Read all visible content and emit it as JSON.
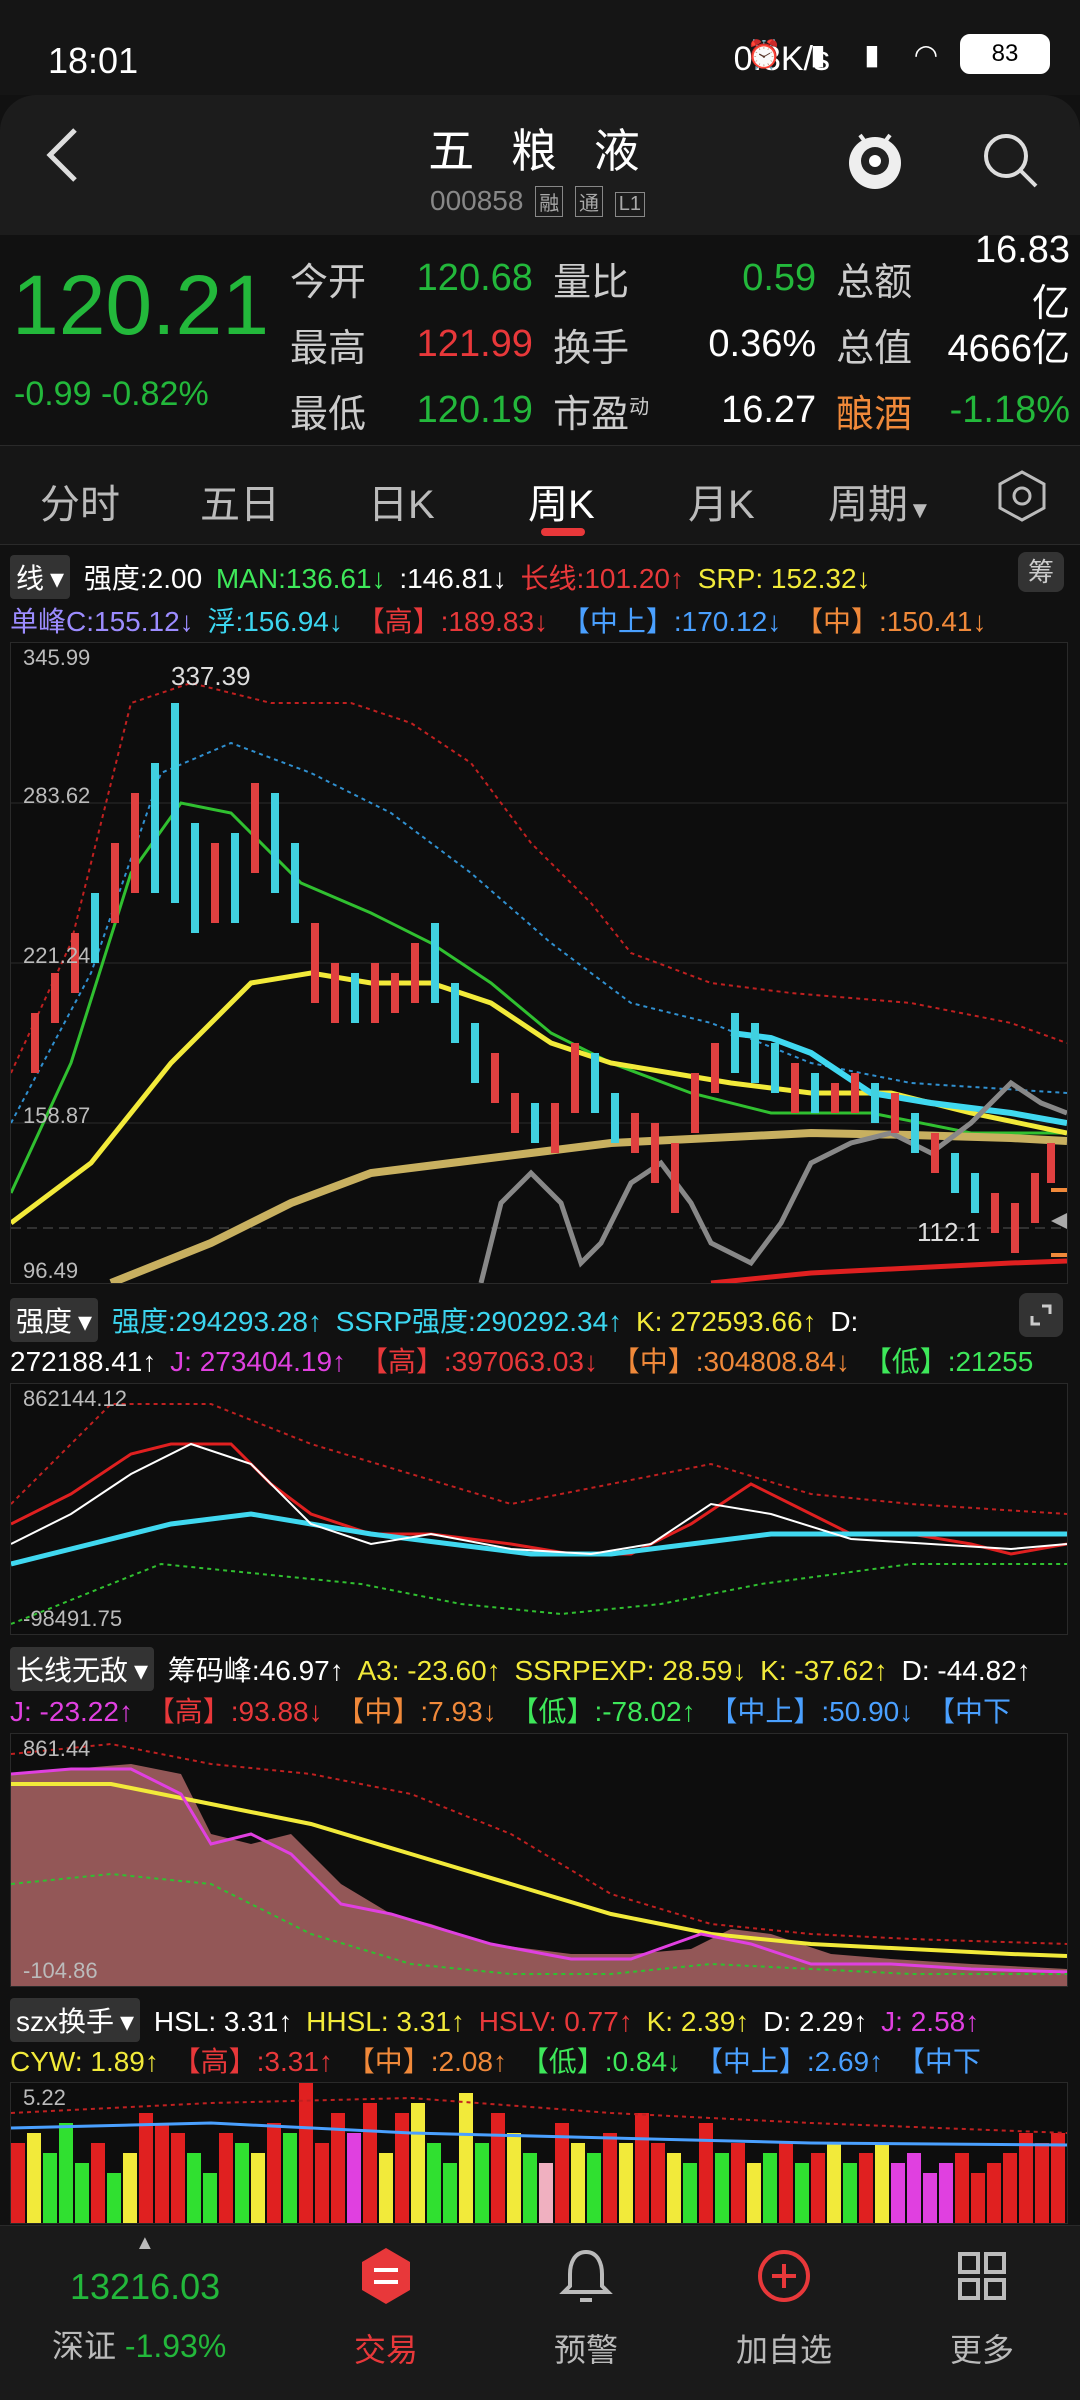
{
  "status": {
    "time": "18:01",
    "speed": "0.3K/s",
    "battery": "83"
  },
  "header": {
    "name": "五 粮 液",
    "code": "000858",
    "tags": [
      "融",
      "通",
      "L1"
    ]
  },
  "quote": {
    "price": "120.21",
    "change": "-0.99",
    "change_pct": "-0.82%",
    "rows": [
      {
        "l1": "今开",
        "v1": "120.68",
        "l2": "量比",
        "v2": "0.59",
        "l3": "总额",
        "v3": "16.83亿"
      },
      {
        "l1": "最高",
        "v1": "121.99",
        "l2": "换手",
        "v2": "0.36%",
        "l3": "总值",
        "v3": "4666亿"
      },
      {
        "l1": "最低",
        "v1": "120.19",
        "l2": "市盈",
        "l2sup": "动",
        "v2": "16.27",
        "l3": "酿酒",
        "v3": "-1.18%"
      }
    ]
  },
  "tabs": [
    "分时",
    "五日",
    "日K",
    "周K",
    "月K",
    "周期"
  ],
  "main_indicator": {
    "selector": "线",
    "line1": {
      "strength": "强度:2.00",
      "man": "MAN:136.61↓",
      "man2": ":146.81↓",
      "long": "长线:101.20↑",
      "srp": "SRP: 152.32↓"
    },
    "line2": {
      "peak": "单峰C:155.12↓",
      "float": "浮:156.94↓",
      "high": "【高】:189.83↓",
      "midup": "【中上】:170.12↓",
      "mid": "【中】:150.41↓"
    },
    "chip_btn": "筹",
    "y_labels": [
      "345.99",
      "283.62",
      "221.24",
      "158.87",
      "96.49"
    ],
    "peak_label": "337.39",
    "low_label": "112.1"
  },
  "strength_indicator": {
    "selector": "强度",
    "line1": {
      "s": "强度:294293.28↑",
      "ssrp": "SSRP强度:290292.34↑",
      "k": "K: 272593.66↑",
      "d": "D:"
    },
    "line2": {
      "dval": "272188.41↑",
      "j": "J: 273404.19↑",
      "high": "【高】:397063.03↓",
      "mid": "【中】:304808.84↓",
      "low": "【低】:21255"
    },
    "y_top": "862144.12",
    "y_bottom": "-98491.75"
  },
  "long_indicator": {
    "selector": "长线无敌",
    "line1": {
      "peak": "筹码峰:46.97↑",
      "a3": "A3: -23.60↑",
      "ssrpexp": "SSRPEXP: 28.59↓",
      "k": "K: -37.62↑",
      "d": "D: -44.82↑"
    },
    "line2": {
      "j": "J: -23.22↑",
      "high": "【高】:93.88↓",
      "mid": "【中】:7.93↓",
      "low": "【低】:-78.02↑",
      "midup": "【中上】:50.90↓",
      "middown": "【中下"
    },
    "y_top": "861.44",
    "y_bottom": "-104.86"
  },
  "turnover_indicator": {
    "selector": "szx换手",
    "line1": {
      "hsl": "HSL: 3.31↑",
      "hhsl": "HHSL: 3.31↑",
      "hslv": "HSLV: 0.77↑",
      "k": "K: 2.39↑",
      "d": "D: 2.29↑",
      "j": "J: 2.58↑"
    },
    "line2": {
      "cyw": "CYW: 1.89↑",
      "high": "【高】:3.31↑",
      "mid": "【中】:2.08↑",
      "low": "【低】:0.84↓",
      "midup": "【中上】:2.69↑",
      "middown": "【中下"
    },
    "y_top": "5.22"
  },
  "bottom": {
    "index_value": "13216.03",
    "index_name": "深证",
    "index_change": "-1.93%",
    "nav": [
      "交易",
      "预警",
      "加自选",
      "更多"
    ]
  }
}
